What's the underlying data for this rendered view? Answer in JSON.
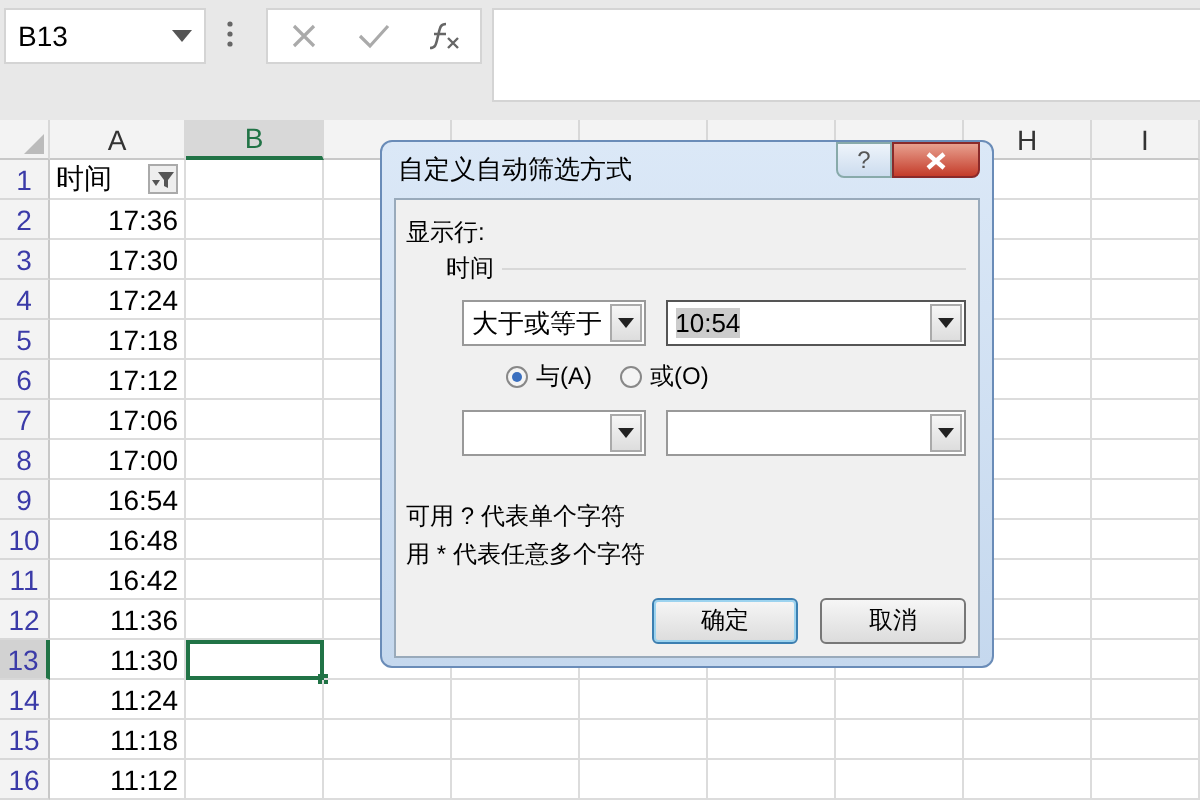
{
  "name_box": {
    "value": "B13"
  },
  "formula_bar": {
    "buttons": [
      {
        "kind": "cancel"
      },
      {
        "kind": "enter"
      },
      {
        "kind": "function"
      }
    ]
  },
  "columns": [
    {
      "label": "A",
      "selected": false
    },
    {
      "label": "B",
      "selected": true
    },
    {
      "selected": false
    },
    {
      "selected": false
    },
    {
      "selected": false
    },
    {
      "selected": false
    },
    {
      "selected": false
    },
    {
      "label": "H",
      "selected": false
    },
    {
      "label": "I",
      "selected": false
    }
  ],
  "rows": [
    {
      "number": "1",
      "selected": false,
      "cells": [
        {
          "value": "时间",
          "filter": true
        }
      ]
    },
    {
      "number": "2",
      "selected": false,
      "cells": [
        {
          "value": "17:36"
        }
      ]
    },
    {
      "number": "3",
      "selected": false,
      "cells": [
        {
          "value": "17:30"
        }
      ]
    },
    {
      "number": "4",
      "selected": false,
      "cells": [
        {
          "value": "17:24"
        }
      ]
    },
    {
      "number": "5",
      "selected": false,
      "cells": [
        {
          "value": "17:18"
        }
      ]
    },
    {
      "number": "6",
      "selected": false,
      "cells": [
        {
          "value": "17:12"
        }
      ]
    },
    {
      "number": "7",
      "selected": false,
      "cells": [
        {
          "value": "17:06"
        }
      ]
    },
    {
      "number": "8",
      "selected": false,
      "cells": [
        {
          "value": "17:00"
        }
      ]
    },
    {
      "number": "9",
      "selected": false,
      "cells": [
        {
          "value": "16:54"
        }
      ]
    },
    {
      "number": "10",
      "selected": false,
      "cells": [
        {
          "value": "16:48"
        }
      ]
    },
    {
      "number": "11",
      "selected": false,
      "cells": [
        {
          "value": "16:42"
        }
      ]
    },
    {
      "number": "12",
      "selected": false,
      "cells": [
        {
          "value": "11:36"
        }
      ]
    },
    {
      "number": "13",
      "selected": true,
      "cells": [
        {
          "value": "11:30"
        }
      ]
    },
    {
      "number": "14",
      "selected": false,
      "cells": [
        {
          "value": "11:24"
        }
      ]
    },
    {
      "number": "15",
      "selected": false,
      "cells": [
        {
          "value": "11:18"
        }
      ]
    },
    {
      "number": "16",
      "selected": false,
      "cells": [
        {
          "value": "11:12"
        }
      ]
    }
  ],
  "dialog": {
    "title": "自定义自动筛选方式",
    "help": "?",
    "show_rows_label": "显示行:",
    "field_label": "时间",
    "criteria": [
      {
        "operator": "大于或等于",
        "value": "10:54",
        "value_selected": true
      },
      {
        "value_selected": false
      }
    ],
    "logic": [
      {
        "label": "与(A)",
        "selected": true
      },
      {
        "label": "或(O)",
        "selected": false
      }
    ],
    "hints": [
      "可用 ? 代表单个字符",
      "用 * 代表任意多个字符"
    ],
    "buttons": [
      {
        "label": "确定",
        "default": true
      },
      {
        "label": "取消",
        "default": false
      }
    ]
  }
}
